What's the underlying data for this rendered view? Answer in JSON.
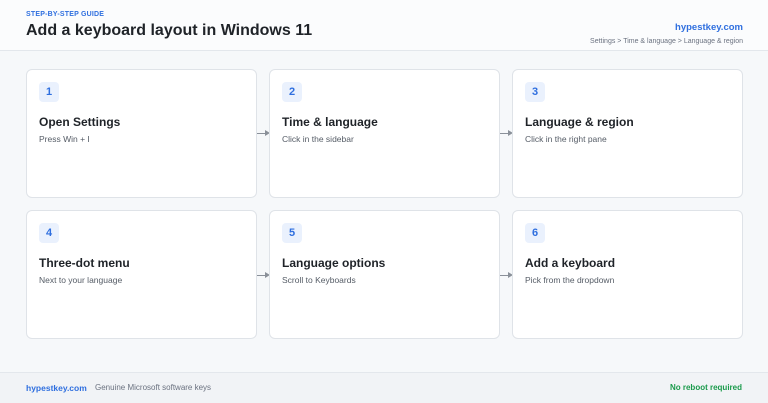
{
  "header": {
    "eyebrow": "STEP-BY-STEP GUIDE",
    "title": "Add a keyboard layout in Windows 11",
    "brand": "hypestkey.com",
    "breadcrumb": "Settings > Time & language > Language & region"
  },
  "steps": [
    {
      "number": "1",
      "title": "Open Settings",
      "description": "Press Win + I"
    },
    {
      "number": "2",
      "title": "Time & language",
      "description": "Click in the sidebar"
    },
    {
      "number": "3",
      "title": "Language & region",
      "description": "Click in the right pane"
    },
    {
      "number": "4",
      "title": "Three-dot menu",
      "description": "Next to your language"
    },
    {
      "number": "5",
      "title": "Language options",
      "description": "Scroll to Keyboards"
    },
    {
      "number": "6",
      "title": "Add a keyboard",
      "description": "Pick from the dropdown"
    }
  ],
  "footer": {
    "brand": "hypestkey.com",
    "tagline": "Genuine Microsoft software keys",
    "status": "No reboot required"
  },
  "colors": {
    "accent": "#2f6fdf",
    "success": "#1a9a4b"
  }
}
